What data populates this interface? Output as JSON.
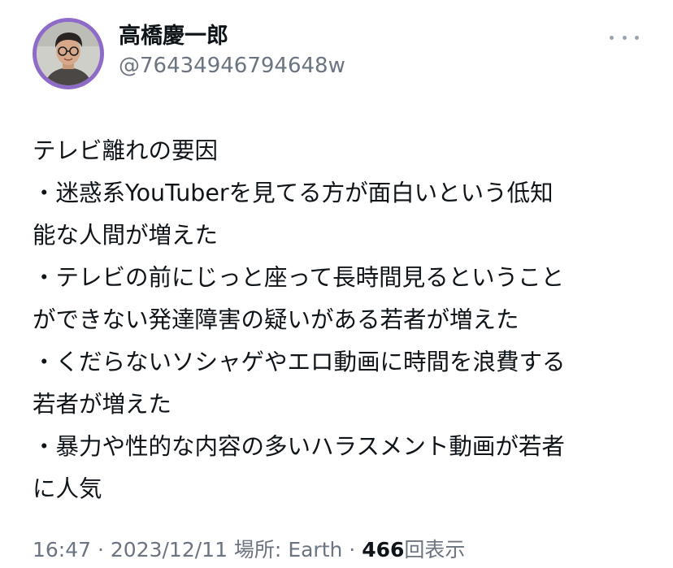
{
  "author": {
    "display_name": "高橋慶一郎",
    "handle": "@76434946794648w"
  },
  "tweet": {
    "lines": [
      "テレビ離れの要因",
      "・迷惑系YouTuberを見てる方が面白いという低知",
      "能な人間が増えた",
      "・テレビの前にじっと座って長時間見るということ",
      "ができない発達障害の疑いがある若者が増えた",
      "・くだらないソシャゲやエロ動画に時間を浪費する",
      "若者が増えた",
      "・暴力や性的な内容の多いハラスメント動画が若者",
      "に人気"
    ]
  },
  "meta": {
    "time": "16:47",
    "separator_1": " · ",
    "date": "2023/12/11",
    "location_label": " 場所: ",
    "location": "Earth",
    "separator_2": " · ",
    "views_count": "466",
    "views_label": "回表示"
  },
  "icons": {
    "more": "more-horizontal-icon"
  },
  "colors": {
    "avatar_ring": "#8e6bc9",
    "secondary_text": "#6b7480",
    "primary_text": "#0f1419"
  }
}
